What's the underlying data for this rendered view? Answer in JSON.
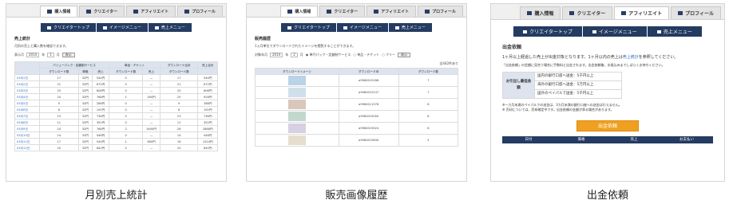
{
  "tabs": [
    "購入情報",
    "クリエイター",
    "アフィリエイト",
    "プロフィール"
  ],
  "nav": [
    "クリエイタートップ",
    "イメージメニュー",
    "売上メニュー"
  ],
  "panel1": {
    "title": "売上統計",
    "desc": "月別の売上と購入数を確認できます。",
    "filter": {
      "label": "表示月",
      "year": "2014",
      "year_unit": "年",
      "month": "1",
      "month_unit": "月",
      "button": "表示"
    },
    "headers": [
      "バリューパック・定額制サービス",
      "単品・チケット",
      "ダウンロード合計",
      "売上合計"
    ],
    "subheaders": [
      "ダウンロード数",
      "単価",
      "売上",
      "ダウンロード数",
      "売上",
      "ダウンロード数"
    ],
    "rows": [
      [
        "03月1日",
        "17",
        "32円",
        "544円",
        "0",
        "—",
        "17",
        "544円"
      ],
      [
        "03月2日",
        "21",
        "32円",
        "672円",
        "0",
        "—",
        "21",
        "672円"
      ],
      [
        "03月3日",
        "20",
        "32円",
        "608円",
        "0",
        "—",
        "20",
        "608円"
      ],
      [
        "03月4日",
        "24",
        "32円",
        "768円",
        "1",
        "160円",
        "25",
        "928円"
      ],
      [
        "03月5日",
        "9",
        "32円",
        "288円",
        "0",
        "—",
        "9",
        "288円"
      ],
      [
        "03月6日",
        "8",
        "32円",
        "192円",
        "0",
        "—",
        "6",
        "192円"
      ],
      [
        "03月7日",
        "23",
        "32円",
        "736円",
        "0",
        "—",
        "23",
        "736円"
      ],
      [
        "03月8日",
        "11",
        "32円",
        "352円",
        "0",
        "—",
        "11",
        "352円"
      ],
      [
        "03月9日",
        "24",
        "32円",
        "768円",
        "2",
        "1600円",
        "26",
        "2888円"
      ],
      [
        "03月10日",
        "14",
        "32円",
        "448円",
        "0",
        "—",
        "14",
        "448円"
      ],
      [
        "03月11日",
        "17",
        "32円",
        "544円",
        "1",
        "980円",
        "18",
        "1524円"
      ],
      [
        "03月12日",
        "20",
        "32円",
        "640円",
        "0",
        "—",
        "20",
        "640円"
      ]
    ]
  },
  "panel2": {
    "title": "販売履歴",
    "desc": "1ヵ月単位でダウンロードされたイメージを閲覧することができます。",
    "filter": {
      "label": "対象年月",
      "year": "2014",
      "year_unit": "年",
      "month": "2",
      "month_unit": "月",
      "type1": "単円パック・定額制サービス",
      "type2": "単品・チケット",
      "type3": "フリー",
      "button": "表示"
    },
    "count": "全442件あり",
    "headers": [
      "ダウンロードイメージ",
      "ダウンロードID",
      "ダウンロード数"
    ],
    "rows": [
      [
        "a9960019186",
        "7"
      ],
      [
        "a9960019137",
        "7"
      ],
      [
        "a9960011578",
        "8"
      ],
      [
        "a9960019050",
        "8"
      ],
      [
        "a9960019024",
        "6"
      ],
      [
        "a9960019630",
        "5"
      ]
    ],
    "thumb_colors": [
      "#b9d3e8",
      "#cfe0ea",
      "#d9c7bb",
      "#c2d8cf",
      "#d6d0e2",
      "#e6ddcc"
    ]
  },
  "panel3": {
    "title": "出金依頼",
    "line1a": "1ヶ月以上経過した売上が出金対象となります。1ヶ月以内の売上は",
    "line1_link": "売上統計",
    "line1b": "を参照してください。",
    "note": "「出金依頼」の定額に見合う場合に手数料と出金されます。出金依頼後、お振込みまでしばらくお待ちください。",
    "fee_label": "お引出し最低金額",
    "fees": [
      "国内の銀行口座へ送金：5千円以上",
      "海外の銀行口座へ送金：5万円以上",
      "国外のペイパルで送金：5千円以上"
    ],
    "notes": [
      "※一カ月未満のペイパルでの送金は、3カ月未満の銀行口座への送金は行えません。",
      "※ 売却については、売却確定中です。出金依頼の金額が承る場合があります。"
    ],
    "button": "出金依頼",
    "history_headers": [
      "日付",
      "価格",
      "売上",
      "お支払い"
    ]
  },
  "captions": [
    "月別売上統計",
    "販売画像履歴",
    "出金依頼"
  ],
  "colors": {
    "nav": "#243b62",
    "accent": "#f0a020",
    "link": "#2b6dc4"
  }
}
